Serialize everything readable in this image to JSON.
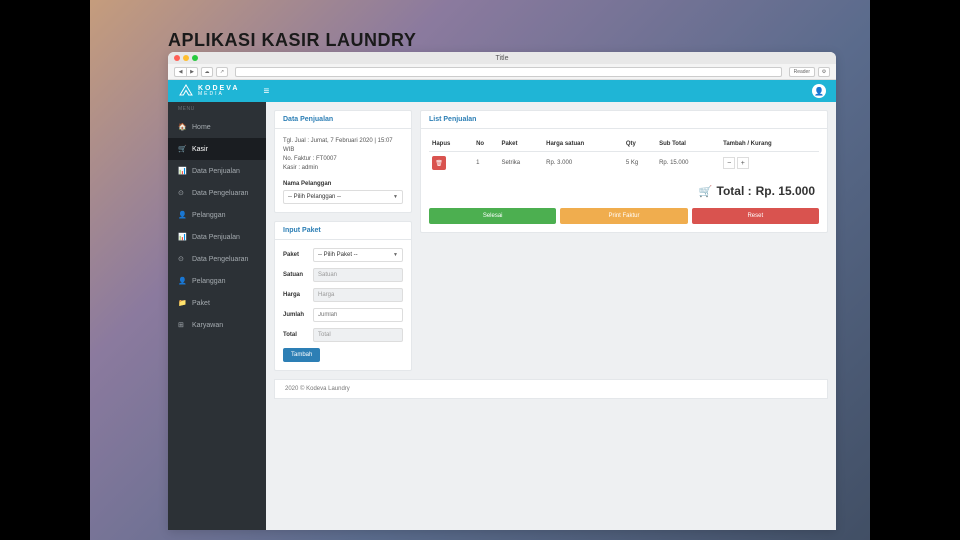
{
  "app_title": "APLIKASI KASIR LAUNDRY",
  "window_title": "Title",
  "reader_label": "Reader",
  "brand": {
    "line1": "KODEVA",
    "line2": "MEDIA"
  },
  "sidebar": {
    "menu_label": "MENU",
    "items": [
      {
        "label": "Home",
        "icon": "🏠"
      },
      {
        "label": "Kasir",
        "icon": "🛒"
      },
      {
        "label": "Data Penjualan",
        "icon": "📊"
      },
      {
        "label": "Data Pengeluaran",
        "icon": "⊙"
      },
      {
        "label": "Pelanggan",
        "icon": "👤"
      },
      {
        "label": "Data Penjualan",
        "icon": "📊"
      },
      {
        "label": "Data Pengeluaran",
        "icon": "⊙"
      },
      {
        "label": "Pelanggan",
        "icon": "👤"
      },
      {
        "label": "Paket",
        "icon": "📁"
      },
      {
        "label": "Karyawan",
        "icon": "⊞"
      }
    ]
  },
  "data_penjualan": {
    "title": "Data Penjualan",
    "tgl": "Tgl. Jual :  Jumat, 7 Februari 2020 | 15:07 WIB",
    "faktur": "No. Faktur : FT0007",
    "kasir": "Kasir : admin",
    "nama_label": "Nama Pelanggan",
    "nama_placeholder": "-- Pilih Pelanggan --"
  },
  "input_paket": {
    "title": "Input Paket",
    "labels": {
      "paket": "Paket",
      "satuan": "Satuan",
      "harga": "Harga",
      "jumlah": "Jumlah",
      "total": "Total"
    },
    "placeholders": {
      "paket": "-- Pilih Paket --",
      "satuan": "Satuan",
      "harga": "Harga",
      "jumlah": "Jumlah",
      "total": "Total"
    },
    "tambah": "Tambah"
  },
  "list_penjualan": {
    "title": "List Penjualan",
    "headers": {
      "hapus": "Hapus",
      "no": "No",
      "paket": "Paket",
      "harga": "Harga satuan",
      "qty": "Qty",
      "subtotal": "Sub Total",
      "tambah": "Tambah / Kurang"
    },
    "rows": [
      {
        "no": "1",
        "paket": "Setrika",
        "harga": "Rp. 3.000",
        "qty": "5 Kg",
        "subtotal": "Rp. 15.000"
      }
    ],
    "total_label": "Total :",
    "total_value": "Rp. 15.000",
    "actions": {
      "selesai": "Selesai",
      "print": "Print Faktur",
      "reset": "Reset"
    }
  },
  "footer": "2020 © Kodeva Laundry"
}
